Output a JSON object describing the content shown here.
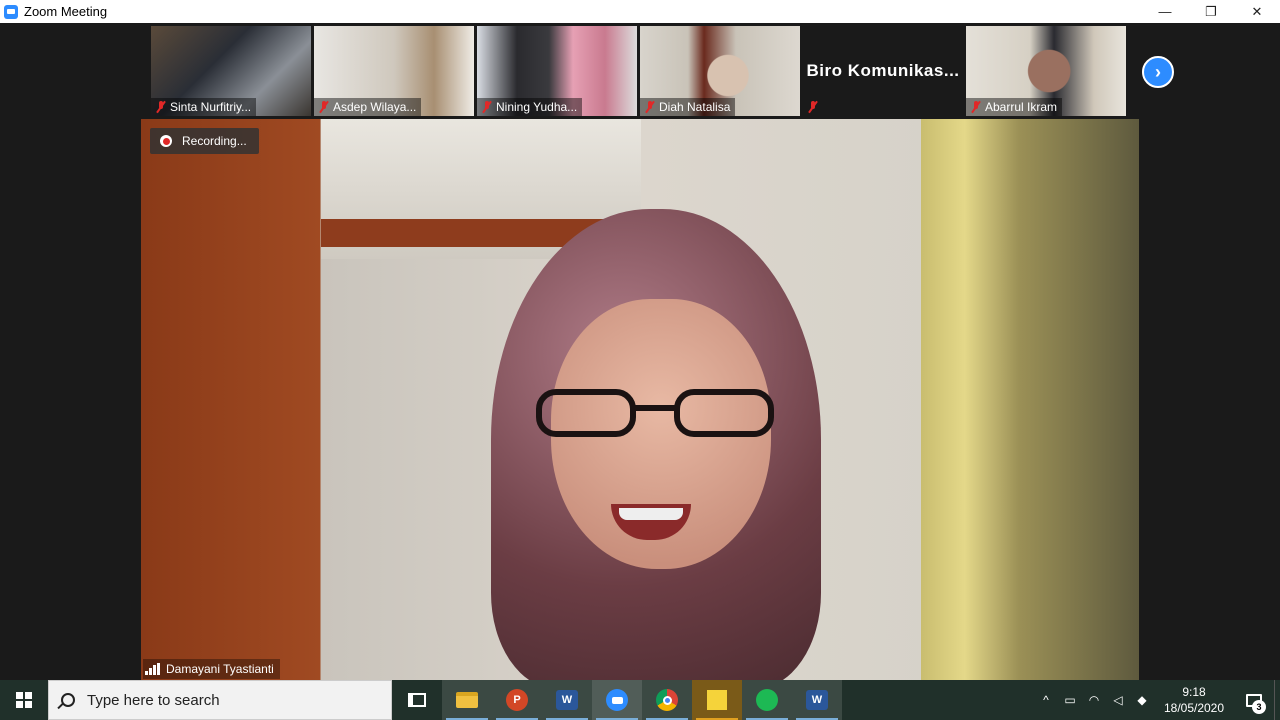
{
  "window": {
    "title": "Zoom Meeting",
    "minimize": "—",
    "restore": "❐",
    "close": "✕"
  },
  "thumbnails": [
    {
      "name": "Sinta Nurfitriy...",
      "muted": true
    },
    {
      "name": "Asdep Wilaya...",
      "muted": true
    },
    {
      "name": "Nining Yudha...",
      "muted": true
    },
    {
      "name": "Diah Natalisa",
      "muted": true
    },
    {
      "name": "",
      "display_name": "Biro  Komunikas...",
      "muted": true
    },
    {
      "name": "Abarrul Ikram",
      "muted": true
    }
  ],
  "next_page": "›",
  "recording": {
    "label": "Recording..."
  },
  "active_speaker": {
    "name": "Damayani Tyastianti"
  },
  "taskbar": {
    "search_placeholder": "Type here to search",
    "apps": [
      {
        "id": "task-view",
        "icon": "task-view-icon"
      },
      {
        "id": "file-explorer",
        "icon": "folder-icon"
      },
      {
        "id": "powerpoint",
        "icon": "powerpoint-icon",
        "glyph": "P"
      },
      {
        "id": "word",
        "icon": "word-icon",
        "glyph": "W"
      },
      {
        "id": "zoom",
        "icon": "zoom-icon",
        "active": true
      },
      {
        "id": "chrome",
        "icon": "chrome-icon"
      },
      {
        "id": "sticky-notes",
        "icon": "sticky-notes-icon"
      },
      {
        "id": "spotify",
        "icon": "spotify-icon"
      },
      {
        "id": "word-2",
        "icon": "word-icon",
        "glyph": "W"
      }
    ],
    "tray": {
      "chevron": "^",
      "time": "9:18",
      "date": "18/05/2020",
      "notifications": "3"
    }
  },
  "colors": {
    "zoom_blue": "#2d8cff",
    "muted_red": "#e02828",
    "taskbar_bg": "#20302a"
  }
}
